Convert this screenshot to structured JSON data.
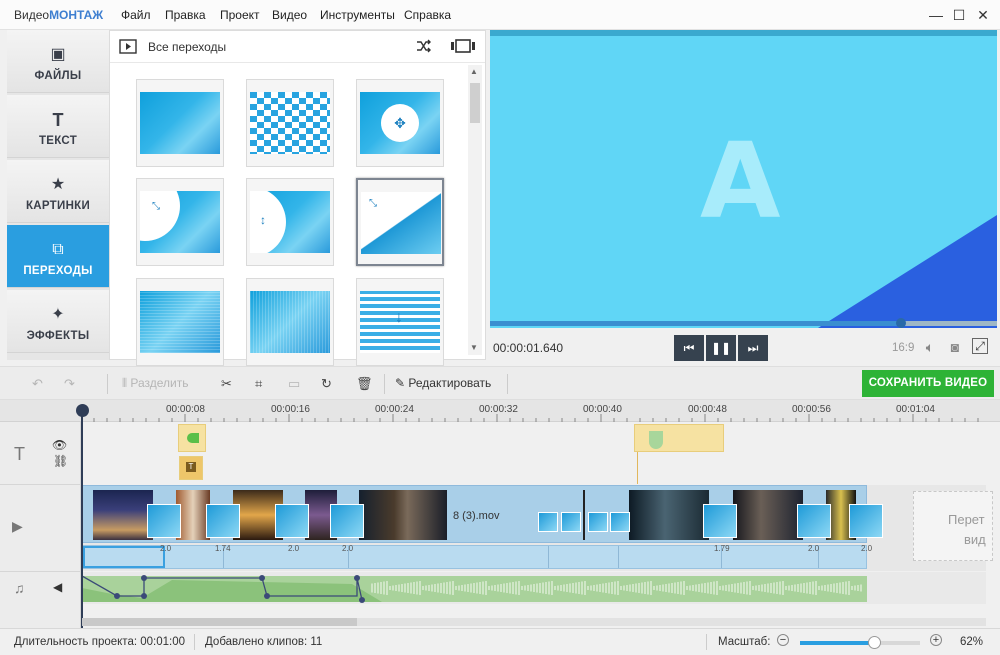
{
  "app": {
    "title_prefix": "Видео",
    "title_brand": "МОНТАЖ"
  },
  "menu": [
    "Файл",
    "Правка",
    "Проект",
    "Видео",
    "Инструменты",
    "Справка"
  ],
  "window_controls": {
    "minimize": "—",
    "maximize": "☐",
    "close": "✕"
  },
  "sidebar": {
    "items": [
      {
        "label": "ФАЙЛЫ",
        "icon": "image-icon",
        "glyph": "▣",
        "active": false
      },
      {
        "label": "ТЕКСТ",
        "icon": "text-icon",
        "glyph": "T",
        "active": false
      },
      {
        "label": "КАРТИНКИ",
        "icon": "star-icon",
        "glyph": "★",
        "active": false
      },
      {
        "label": "ПЕРЕХОДЫ",
        "icon": "transition-icon",
        "glyph": "⧉",
        "active": true
      },
      {
        "label": "ЭФФЕКТЫ",
        "icon": "magic-wand-icon",
        "glyph": "✦",
        "active": false
      }
    ]
  },
  "transitions_panel": {
    "title": "Все переходы",
    "selected_index": 5
  },
  "preview": {
    "letter": "A",
    "timecode": "00:00:01.640",
    "progress_fraction": 0.81,
    "aspect": "16:9",
    "accent_color": "#2a60e0"
  },
  "toolbar": {
    "split_label": "Разделить",
    "edit_label": "Редактировать",
    "save_label": "СОХРАНИТЬ ВИДЕО"
  },
  "timeline": {
    "ruler_ticks": [
      "00:00:08",
      "00:00:16",
      "00:00:24",
      "00:00:32",
      "00:00:40",
      "00:00:48",
      "00:00:56",
      "00:01:04"
    ],
    "clip_label": "8 (3).mov",
    "transition_durations": [
      "2.0",
      "1.74",
      "2.0",
      "2.0",
      "1.79",
      "2.0",
      "2.0"
    ],
    "dropzone_text": [
      "Перет",
      "вид"
    ]
  },
  "status": {
    "duration_label": "Длительность проекта:",
    "duration_value": "00:01:00",
    "clips_label": "Добавлено клипов:",
    "clips_value": "11",
    "zoom_label": "Масштаб:",
    "zoom_value": "62%",
    "zoom_fraction": 0.62
  }
}
